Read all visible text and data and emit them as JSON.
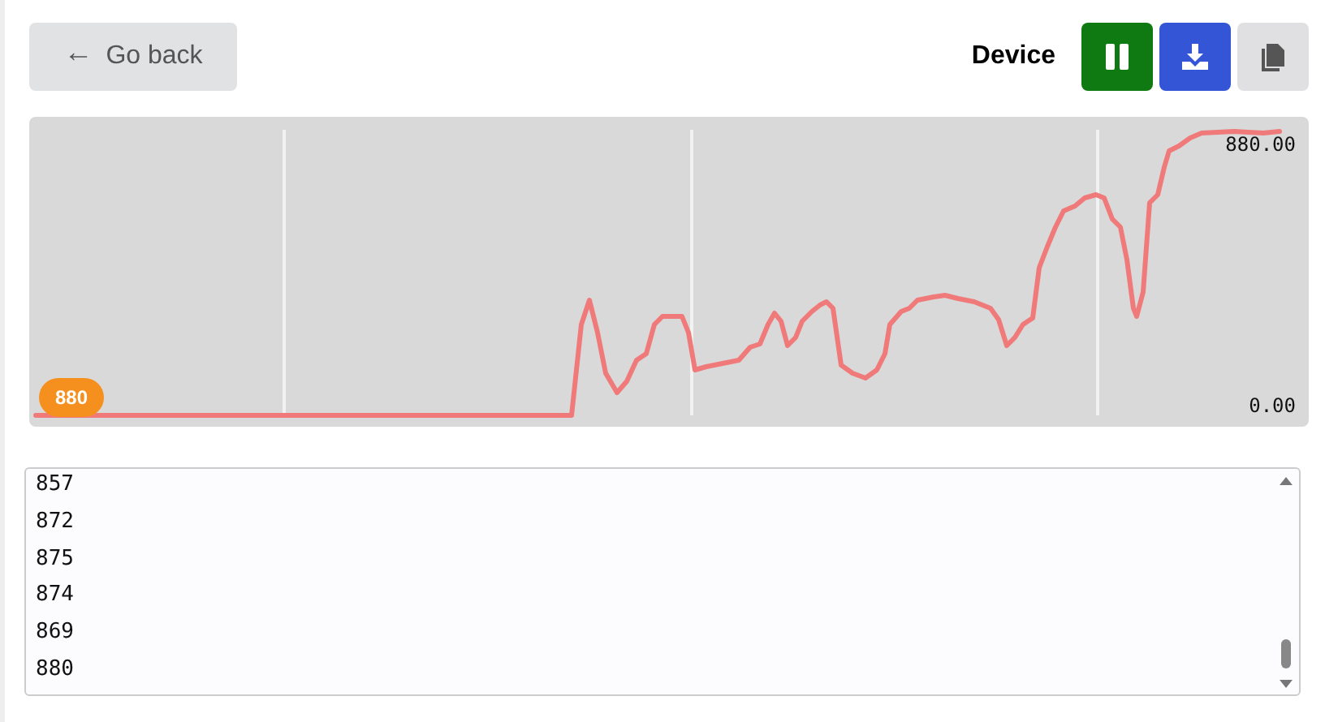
{
  "toolbar": {
    "back_button": {
      "icon": "←",
      "label": "Go back"
    },
    "device_label": "Device",
    "buttons": [
      {
        "kind": "pause",
        "color": "#0f7a12"
      },
      {
        "kind": "download",
        "color": "#3355d6"
      },
      {
        "kind": "copy",
        "color": "#e0e0e2"
      }
    ]
  },
  "plot": {
    "max_label": "880.00",
    "min_label": "0.00",
    "current_value": "880"
  },
  "log": {
    "lines": [
      "857",
      "872",
      "875",
      "874",
      "869",
      "880"
    ]
  }
}
